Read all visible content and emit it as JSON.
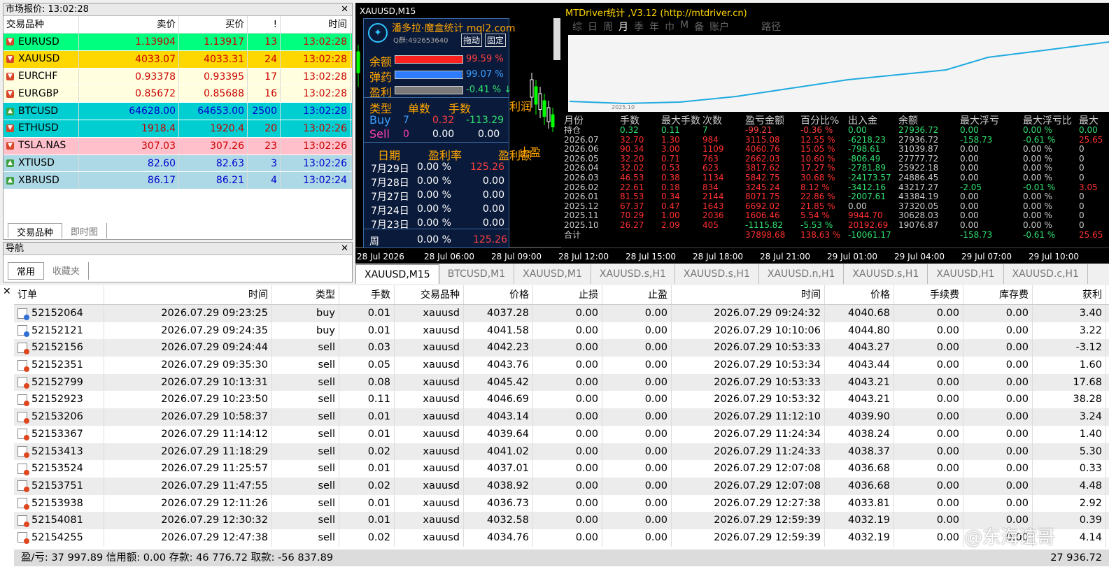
{
  "market_watch": {
    "title": "市场报价: 13:02:28",
    "headers": [
      "交易品种",
      "卖价",
      "买价",
      "!",
      "时间"
    ],
    "rows": [
      {
        "symbol": "EURUSD",
        "bid": "1.13904",
        "ask": "1.13917",
        "spread": "13",
        "time": "13:02:28",
        "dir": "down",
        "bg": "#00ff7f",
        "fg": "#cc0000"
      },
      {
        "symbol": "XAUUSD",
        "bid": "4033.07",
        "ask": "4033.31",
        "spread": "24",
        "time": "13:02:28",
        "dir": "down",
        "bg": "#ffd700",
        "fg": "#cc0000"
      },
      {
        "symbol": "EURCHF",
        "bid": "0.93378",
        "ask": "0.93395",
        "spread": "17",
        "time": "13:02:28",
        "dir": "down",
        "bg": "#ffffe0",
        "fg": "#cc0000"
      },
      {
        "symbol": "EURGBP",
        "bid": "0.85672",
        "ask": "0.85688",
        "spread": "16",
        "time": "13:02:28",
        "dir": "down",
        "bg": "#ffffe0",
        "fg": "#cc0000"
      },
      {
        "symbol": "BTCUSD",
        "bid": "64628.00",
        "ask": "64653.00",
        "spread": "2500",
        "time": "13:02:28",
        "dir": "up",
        "bg": "#00ced1",
        "fg": "#0000cc"
      },
      {
        "symbol": "ETHUSD",
        "bid": "1918.4",
        "ask": "1920.4",
        "spread": "20",
        "time": "13:02:26",
        "dir": "down",
        "bg": "#00ced1",
        "fg": "#cc0000"
      },
      {
        "symbol": "TSLA.NAS",
        "bid": "307.03",
        "ask": "307.26",
        "spread": "23",
        "time": "13:02:26",
        "dir": "down",
        "bg": "#ffc0cb",
        "fg": "#cc0000"
      },
      {
        "symbol": "XTIUSD",
        "bid": "82.60",
        "ask": "82.63",
        "spread": "3",
        "time": "13:02:26",
        "dir": "up",
        "bg": "#add8e6",
        "fg": "#0000cc"
      },
      {
        "symbol": "XBRUSD",
        "bid": "86.17",
        "ask": "86.21",
        "spread": "4",
        "time": "13:02:24",
        "dir": "up",
        "bg": "#add8e6",
        "fg": "#0000cc"
      }
    ],
    "tabs": [
      "交易品种",
      "即时图"
    ]
  },
  "navigator": {
    "title": "导航",
    "tabs": [
      "常用",
      "收藏夹"
    ]
  },
  "chart": {
    "symbol": "XAUUSD,M15",
    "time_axis": [
      "28 Jul 2026",
      "28 Jul 06:00",
      "28 Jul 09:00",
      "28 Jul 12:00",
      "28 Jul 15:00",
      "28 Jul 18:00",
      "28 Jul 21:00",
      "29 Jul 01:00",
      "29 Jul 04:00",
      "29 Jul 07:00",
      "29 Jul 10:00"
    ],
    "profit_label": "利润",
    "stop_label": "止盈"
  },
  "panel": {
    "title": "潘多拉·魔盒统计 mql2.com",
    "qq": "Q群:492653640",
    "btn_move": "拖动",
    "btn_fix": "固定",
    "bars": [
      {
        "label": "余额",
        "value": "99.59 %",
        "color": "#ff2020",
        "fill": 0.996
      },
      {
        "label": "弹药",
        "value": "99.07 %",
        "color": "#2f7dff",
        "fill": 0.991
      },
      {
        "label": "盈利",
        "value": "-0.41 % ↓",
        "color": "#7a7a7a",
        "fill": 1
      }
    ],
    "pos_headers": [
      "类型",
      "单数",
      "手数"
    ],
    "buy": {
      "label": "Buy",
      "count": "7",
      "lots": "0.32",
      "profit": "-113.29"
    },
    "sell": {
      "label": "Sell",
      "count": "0",
      "lots": "0.00",
      "profit": "0.00"
    },
    "day_headers": [
      "日期",
      "盈利率",
      "盈利额"
    ],
    "days": [
      {
        "date": "7月29日",
        "rate": "0.00 %",
        "amount": "125.26",
        "neg": true
      },
      {
        "date": "7月28日",
        "rate": "0.00 %",
        "amount": "0.00",
        "neg": false
      },
      {
        "date": "7月27日",
        "rate": "0.00 %",
        "amount": "0.00",
        "neg": false
      },
      {
        "date": "7月24日",
        "rate": "0.00 %",
        "amount": "0.00",
        "neg": false
      },
      {
        "date": "7月23日",
        "rate": "0.00 %",
        "amount": "0.00",
        "neg": false
      }
    ],
    "week": {
      "label": "周",
      "rate": "0.00 %",
      "amount": "125.26"
    }
  },
  "stats": {
    "title": "MTDriver统计 ,V3.12 (http://mtdriver.cn)",
    "tabs": [
      "综",
      "日",
      "周",
      "月",
      "季",
      "年",
      "巾",
      "M",
      "备",
      "账户",
      "路径"
    ],
    "axis_label": "2025.10",
    "headers": [
      "月份",
      "手数",
      "最大手数",
      "次数",
      "盈亏金额",
      "百分比%",
      "出入金",
      "余额",
      "最大浮亏",
      "最大浮亏比",
      "最大"
    ],
    "rows": [
      [
        "持仓",
        "0.32",
        "0.11",
        "7",
        "-99.21",
        "-0.36 %",
        "0.00",
        "27936.72",
        "0.00",
        "0.00 %",
        "0.00"
      ],
      [
        "2026.07",
        "32.70",
        "1.30",
        "984",
        "3115.08",
        "12.55 %",
        "-6218.23",
        "27936.72",
        "-158.73",
        "-0.61 %",
        "25.65"
      ],
      [
        "2026.06",
        "90.34",
        "3.00",
        "1109",
        "4060.76",
        "15.05 %",
        "-798.61",
        "31039.87",
        "0.00",
        "0.00 %",
        "0"
      ],
      [
        "2026.05",
        "32.20",
        "0.71",
        "763",
        "2662.03",
        "10.60 %",
        "-806.49",
        "27777.72",
        "0.00",
        "0.00 %",
        "0"
      ],
      [
        "2026.04",
        "32.02",
        "0.53",
        "623",
        "3817.62",
        "17.27 %",
        "-2781.89",
        "25922.18",
        "0.00",
        "0.00 %",
        "0"
      ],
      [
        "2026.03",
        "46.53",
        "0.38",
        "1134",
        "5842.75",
        "30.68 %",
        "-24173.57",
        "24886.45",
        "0.00",
        "0.00 %",
        "0"
      ],
      [
        "2026.02",
        "22.61",
        "0.18",
        "834",
        "3245.24",
        "8.12 %",
        "-3412.16",
        "43217.27",
        "-2.05",
        "-0.01 %",
        "3.05"
      ],
      [
        "2026.01",
        "81.53",
        "0.34",
        "2144",
        "8071.75",
        "22.86 %",
        "-2007.61",
        "43384.19",
        "0.00",
        "0.00 %",
        "0"
      ],
      [
        "2025.12",
        "67.37",
        "0.47",
        "1643",
        "6692.02",
        "21.85 %",
        "0.00",
        "37320.05",
        "0.00",
        "0.00 %",
        "0"
      ],
      [
        "2025.11",
        "70.29",
        "1.00",
        "2036",
        "1606.46",
        "5.54 %",
        "9944.70",
        "30628.03",
        "0.00",
        "0.00 %",
        "0"
      ],
      [
        "2025.10",
        "26.27",
        "2.09",
        "405",
        "-1115.82",
        "-5.53 %",
        "20192.69",
        "19076.87",
        "0.00",
        "0.00 %",
        "0"
      ],
      [
        "合计",
        "",
        "",
        "",
        "37898.68",
        "138.63 %",
        "-10061.17",
        "",
        "-158.73",
        "-0.61 %",
        "25.65"
      ]
    ]
  },
  "chart_tabs": [
    "XAUUSD,M15",
    "BTCUSD,M1",
    "XAUUSD,M1",
    "XAUUSD.s,H1",
    "XAUUSD.s,H1",
    "XAUUSD.n,H1",
    "XAUUSD.s,H1",
    "XAUUSD,H1",
    "XAUUSD.c,H1"
  ],
  "terminal": {
    "headers": [
      "订单",
      "时间",
      "类型",
      "手数",
      "交易品种",
      "价格",
      "止损",
      "止盈",
      "时间",
      "价格",
      "手续费",
      "库存费",
      "获利"
    ],
    "rows": [
      [
        "52152064",
        "2026.07.29 09:23:25",
        "buy",
        "0.01",
        "xauusd",
        "4037.28",
        "0.00",
        "0.00",
        "2026.07.29 09:24:32",
        "4040.68",
        "0.00",
        "0.00",
        "3.40"
      ],
      [
        "52152121",
        "2026.07.29 09:24:35",
        "buy",
        "0.01",
        "xauusd",
        "4041.58",
        "0.00",
        "0.00",
        "2026.07.29 10:10:06",
        "4044.80",
        "0.00",
        "0.00",
        "3.22"
      ],
      [
        "52152156",
        "2026.07.29 09:24:44",
        "sell",
        "0.03",
        "xauusd",
        "4042.23",
        "0.00",
        "0.00",
        "2026.07.29 10:53:33",
        "4043.27",
        "0.00",
        "0.00",
        "-3.12"
      ],
      [
        "52152351",
        "2026.07.29 09:35:30",
        "sell",
        "0.05",
        "xauusd",
        "4043.76",
        "0.00",
        "0.00",
        "2026.07.29 10:53:34",
        "4043.44",
        "0.00",
        "0.00",
        "1.60"
      ],
      [
        "52152799",
        "2026.07.29 10:13:31",
        "sell",
        "0.08",
        "xauusd",
        "4045.42",
        "0.00",
        "0.00",
        "2026.07.29 10:53:33",
        "4043.21",
        "0.00",
        "0.00",
        "17.68"
      ],
      [
        "52152923",
        "2026.07.29 10:23:50",
        "sell",
        "0.11",
        "xauusd",
        "4046.69",
        "0.00",
        "0.00",
        "2026.07.29 10:53:32",
        "4043.21",
        "0.00",
        "0.00",
        "38.28"
      ],
      [
        "52153206",
        "2026.07.29 10:58:37",
        "sell",
        "0.01",
        "xauusd",
        "4043.14",
        "0.00",
        "0.00",
        "2026.07.29 11:12:10",
        "4039.90",
        "0.00",
        "0.00",
        "3.24"
      ],
      [
        "52153367",
        "2026.07.29 11:14:12",
        "sell",
        "0.01",
        "xauusd",
        "4039.64",
        "0.00",
        "0.00",
        "2026.07.29 11:24:34",
        "4038.24",
        "0.00",
        "0.00",
        "1.40"
      ],
      [
        "52153413",
        "2026.07.29 11:18:29",
        "sell",
        "0.02",
        "xauusd",
        "4041.02",
        "0.00",
        "0.00",
        "2026.07.29 11:24:33",
        "4038.37",
        "0.00",
        "0.00",
        "5.30"
      ],
      [
        "52153524",
        "2026.07.29 11:25:57",
        "sell",
        "0.01",
        "xauusd",
        "4037.01",
        "0.00",
        "0.00",
        "2026.07.29 12:07:08",
        "4036.68",
        "0.00",
        "0.00",
        "0.33"
      ],
      [
        "52153751",
        "2026.07.29 11:47:55",
        "sell",
        "0.02",
        "xauusd",
        "4038.92",
        "0.00",
        "0.00",
        "2026.07.29 12:07:08",
        "4036.68",
        "0.00",
        "0.00",
        "4.48"
      ],
      [
        "52153938",
        "2026.07.29 12:11:26",
        "sell",
        "0.01",
        "xauusd",
        "4036.73",
        "0.00",
        "0.00",
        "2026.07.29 12:27:38",
        "4033.81",
        "0.00",
        "0.00",
        "2.92"
      ],
      [
        "52154081",
        "2026.07.29 12:30:32",
        "sell",
        "0.01",
        "xauusd",
        "4032.58",
        "0.00",
        "0.00",
        "2026.07.29 12:59:39",
        "4032.19",
        "0.00",
        "0.00",
        "0.39"
      ],
      [
        "52154255",
        "2026.07.29 12:47:38",
        "sell",
        "0.02",
        "xauusd",
        "4034.76",
        "0.00",
        "0.00",
        "2026.07.29 12:59:39",
        "4032.19",
        "0.00",
        "0.00",
        "4.14"
      ]
    ],
    "summary": "盈/亏: 37 997.89  信用额: 0.00  存款: 46 776.72  取款: -56 837.89",
    "total": "27 936.72"
  },
  "watermark": "@东海谊哥"
}
